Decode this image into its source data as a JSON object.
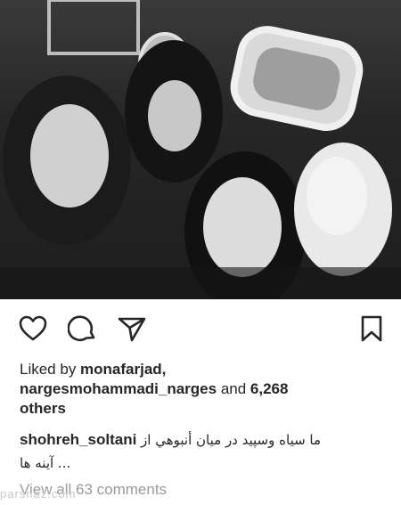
{
  "post": {
    "image_icon": "selfie-photo",
    "likes": {
      "prefix": "Liked by ",
      "user1": "monafarjad,",
      "user2": "nargesmohammadi_narges",
      "and": " and ",
      "count": "6,268",
      "suffix": "others"
    },
    "caption": {
      "username": "shohreh_soltani",
      "text": "ما سیاه وسپید در میان أنبوهي از",
      "more": "... آینه ها"
    },
    "view_comments": "View all 63 comments",
    "watermark": "parsnaz.com"
  },
  "icons": {
    "like": "heart-icon",
    "comment": "comment-bubble-icon",
    "share": "paper-plane-icon",
    "save": "bookmark-icon"
  }
}
